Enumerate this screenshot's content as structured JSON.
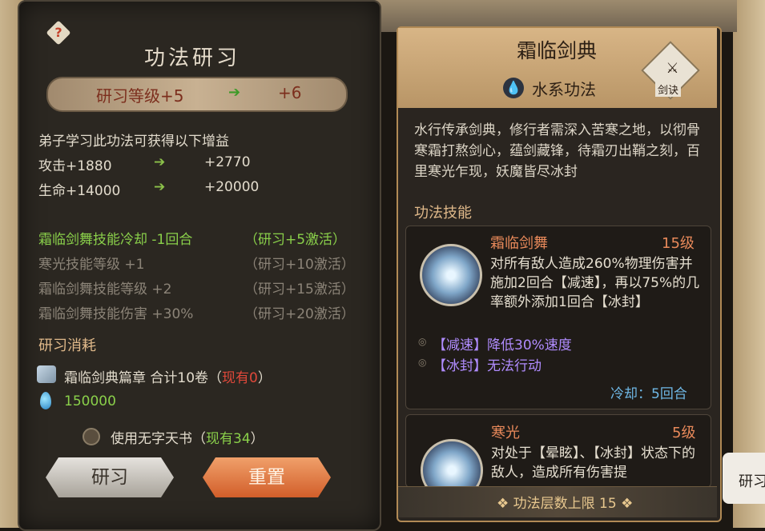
{
  "left": {
    "title": "功法研习",
    "level_label": "研习等级+5",
    "level_next": "+6",
    "gain_intro": "弟子学习此功法可获得以下增益",
    "stats": [
      {
        "label": "攻击+1880",
        "next": "+2770"
      },
      {
        "label": "生命+14000",
        "next": "+20000"
      }
    ],
    "bonuses": [
      {
        "effect": "霜临剑舞技能冷却 -1回合",
        "req": "（研习+5激活）",
        "active": true
      },
      {
        "effect": "寒光技能等级 +1",
        "req": "（研习+10激活）",
        "active": false
      },
      {
        "effect": "霜临剑舞技能等级 +2",
        "req": "（研习+15激活）",
        "active": false
      },
      {
        "effect": "霜临剑舞技能伤害 +30%",
        "req": "（研习+20激活）",
        "active": false
      }
    ],
    "cost_header": "研习消耗",
    "cost_item": "霜临剑典篇章  合计10卷（",
    "cost_have": "现有0",
    "cost_close": "）",
    "cost_spirit": "150000",
    "use_book": "使用无字天书（",
    "use_book_have": "现有34",
    "use_book_close": "）",
    "btn_research": "研习",
    "btn_reset": "重置"
  },
  "right": {
    "title": "霜临剑典",
    "subtitle": "水系功法",
    "badge": "剑诀",
    "description": "水行传承剑典，修行者需深入苦寒之地，以彻骨寒霜打熬剑心，蕴剑藏锋，待霜刃出鞘之刻，百里寒光乍现，妖魔皆尽冰封",
    "skills_header": "功法技能",
    "skills": [
      {
        "name": "霜临剑舞",
        "level": "15级",
        "desc": "对所有敌人造成260%物理伤害并施加2回合【减速】，再以75%的几率额外添加1回合【冰封】",
        "statuses": [
          "【减速】降低30%速度",
          "【冰封】无法行动"
        ],
        "cooldown": "冷却：5回合"
      },
      {
        "name": "寒光",
        "level": "5级",
        "desc": "对处于【晕眩】、【冰封】状态下的敌人，造成所有伤害提"
      }
    ],
    "footer": "功法层数上限 15"
  },
  "side_tab": "研习",
  "colors": {
    "active": "#8ad04a",
    "inactive": "#8c8478",
    "accent": "#e8895a",
    "warning": "#e0483a"
  }
}
